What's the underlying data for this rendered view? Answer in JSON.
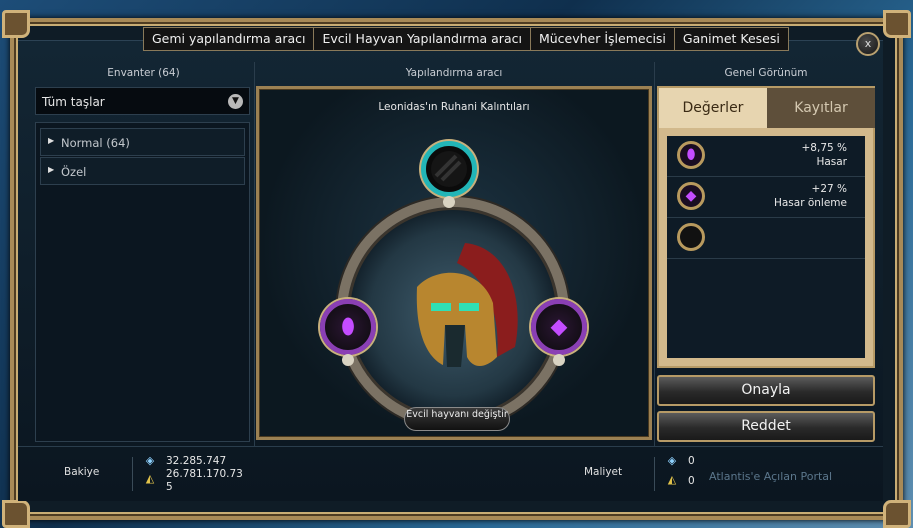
{
  "tabs": [
    {
      "label": "Gemi yapılandırma aracı"
    },
    {
      "label": "Evcil Hayvan Yapılandırma aracı"
    },
    {
      "label": "Mücevher İşlemecisi"
    },
    {
      "label": "Ganimet Kesesi"
    }
  ],
  "close_label": "x",
  "inventory": {
    "title": "Envanter (64)",
    "filter_value": "Tüm taşlar",
    "categories": [
      {
        "label": "Normal (64)"
      },
      {
        "label": "Özel"
      }
    ]
  },
  "configurator": {
    "title": "Yapılandırma aracı",
    "item_name": "Leonidas'ın Ruhani Kalıntıları",
    "change_button": "Evcil hayvanı değiştir"
  },
  "overview": {
    "title": "Genel Görünüm",
    "tabs": [
      {
        "label": "Değerler"
      },
      {
        "label": "Kayıtlar"
      }
    ],
    "stats": [
      {
        "value": "+8,75 %",
        "name": "Hasar",
        "icon": "purple-gem-icon"
      },
      {
        "value": "+27 %",
        "name": "Hasar önleme",
        "icon": "purple-diamond-icon"
      },
      {
        "value": "",
        "name": "",
        "icon": "empty-socket-icon"
      }
    ]
  },
  "buttons": {
    "confirm": "Onayla",
    "reject": "Reddet"
  },
  "balance": {
    "label": "Bakiye",
    "blue_amount": "32.285.747",
    "gold_amount_line1": "26.781.170.73",
    "gold_amount_line2": "5"
  },
  "cost": {
    "label": "Maliyet",
    "blue_amount": "0",
    "gold_amount": "0"
  },
  "background_text": "Atlantis'e Açılan Portal"
}
